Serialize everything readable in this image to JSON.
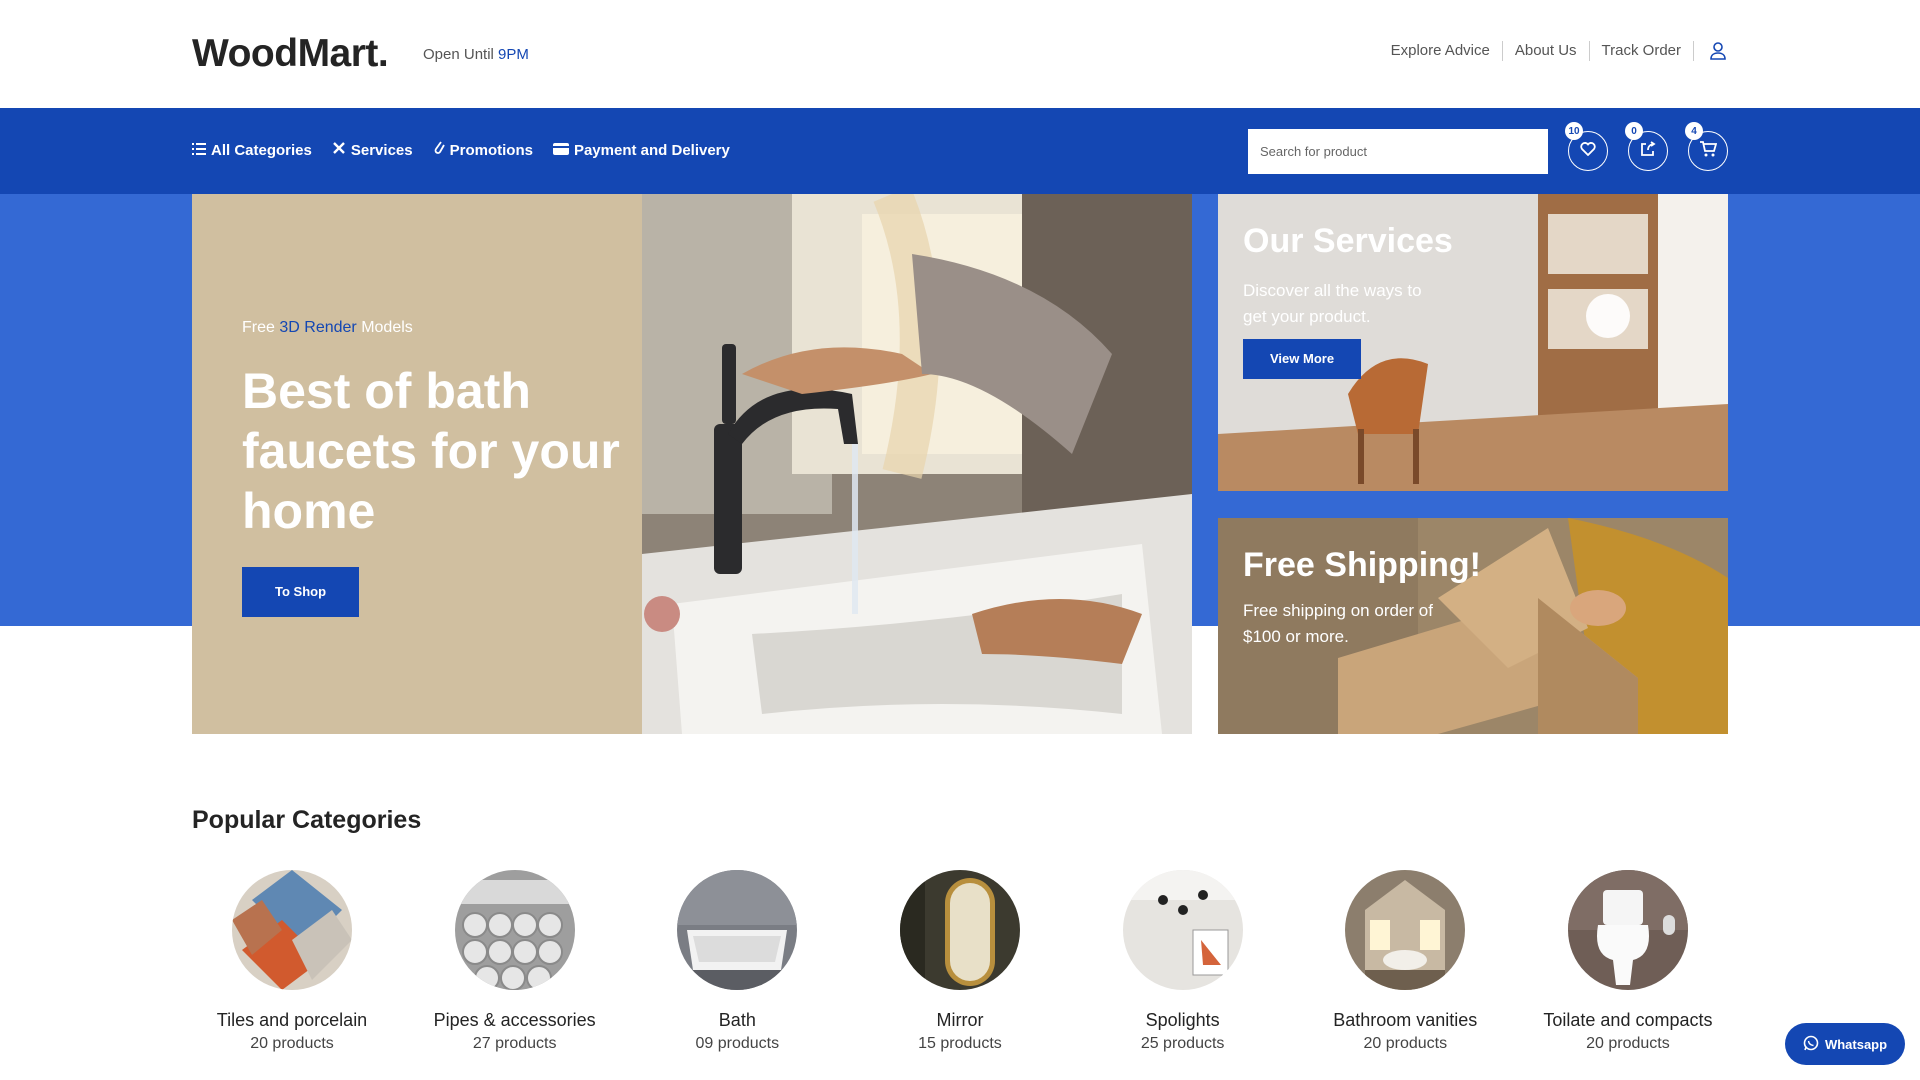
{
  "header": {
    "logo": "WoodMart.",
    "open_until_prefix": "Open Until",
    "open_until_time": "9PM",
    "links": [
      "Explore Advice",
      "About Us",
      "Track Order"
    ]
  },
  "nav": {
    "items": [
      {
        "label": "All Categories",
        "icon": "list-icon"
      },
      {
        "label": "Services",
        "icon": "tools-icon"
      },
      {
        "label": "Promotions",
        "icon": "tag-icon"
      },
      {
        "label": "Payment and Delivery",
        "icon": "credit-card-icon"
      }
    ],
    "search_placeholder": "Search for product",
    "wishlist_count": "10",
    "compare_count": "0",
    "cart_count": "4"
  },
  "hero": {
    "sub_prefix": "Free",
    "sub_highlight": "3D Render",
    "sub_suffix": "Models",
    "title": "Best of bath faucets for your home",
    "button": "To Shop"
  },
  "banners": {
    "services": {
      "title": "Our Services",
      "desc": "Discover all the ways to get your product.",
      "button": "View More"
    },
    "shipping": {
      "title": "Free Shipping!",
      "desc": "Free shipping on order of $100 or more."
    }
  },
  "categories": {
    "title": "Popular Categories",
    "items": [
      {
        "name": "Tiles and porcelain",
        "count": "20 products"
      },
      {
        "name": "Pipes & accessories",
        "count": "27 products"
      },
      {
        "name": "Bath",
        "count": "09 products"
      },
      {
        "name": "Mirror",
        "count": "15 products"
      },
      {
        "name": "Spolights",
        "count": "25 products"
      },
      {
        "name": "Bathroom vanities",
        "count": "20 products"
      },
      {
        "name": "Toilate and compacts",
        "count": "20 products"
      }
    ]
  },
  "whatsapp": {
    "label": "Whatsapp"
  },
  "colors": {
    "primary": "#1447b3",
    "band": "#3469d4",
    "hero_bg": "#d0bfa0"
  }
}
